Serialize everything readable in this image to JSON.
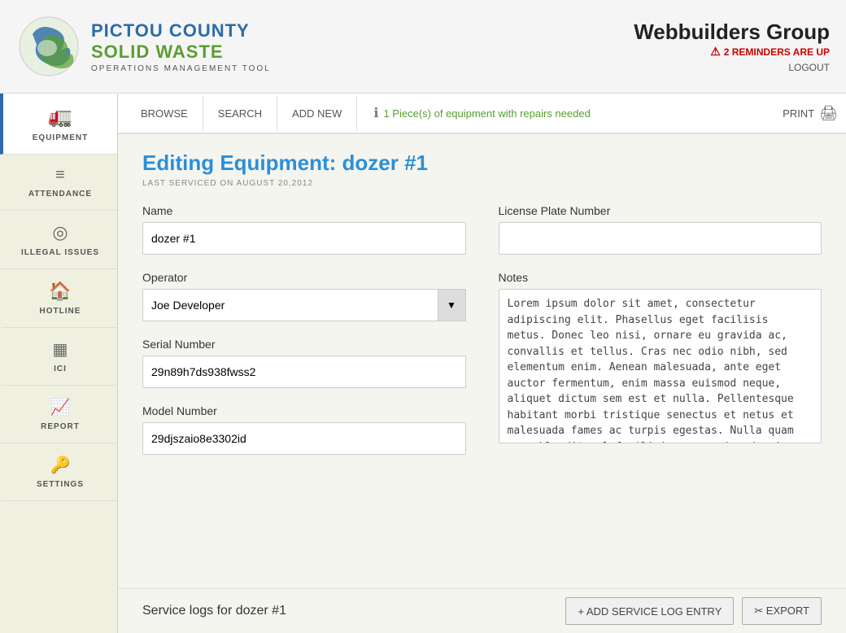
{
  "header": {
    "company": "Webbuilders Group",
    "reminders_text": "2 REMINDERS ARE UP",
    "logout": "LOGOUT",
    "logo_line1": "PICTOU COUNTY",
    "logo_line2": "SOLID WASTE",
    "logo_subtitle": "OPERATIONS MANAGEMENT TOOL"
  },
  "sidebar": {
    "items": [
      {
        "id": "equipment",
        "label": "EQUIPMENT",
        "icon": "🚛",
        "active": true
      },
      {
        "id": "attendance",
        "label": "ATTENDANCE",
        "icon": "≡",
        "active": false
      },
      {
        "id": "illegal-issues",
        "label": "ILLEGAL ISSUES",
        "icon": "◎",
        "active": false
      },
      {
        "id": "hotline",
        "label": "HOTLINE",
        "icon": "🏠",
        "active": false
      },
      {
        "id": "ici",
        "label": "ICI",
        "icon": "▦",
        "active": false
      },
      {
        "id": "report",
        "label": "REPORT",
        "icon": "📈",
        "active": false
      },
      {
        "id": "settings",
        "label": "SETTINGS",
        "icon": "🔑",
        "active": false
      }
    ]
  },
  "tabs": [
    {
      "label": "BROWSE"
    },
    {
      "label": "SEARCH"
    },
    {
      "label": "ADD NEW"
    }
  ],
  "tab_alert": "1 Piece(s) of equipment with repairs needed",
  "print_label": "PRINT",
  "form": {
    "title": "Editing Equipment: dozer #1",
    "subtitle": "LAST SERVICED ON AUGUST 20,2012",
    "name_label": "Name",
    "name_value": "dozer #1",
    "license_label": "License Plate Number",
    "license_value": "",
    "operator_label": "Operator",
    "operator_value": "Joe Developer",
    "notes_label": "Notes",
    "notes_value": "Lorem ipsum dolor sit amet, consectetur adipiscing elit. Phasellus eget facilisis metus. Donec leo nisi, ornare eu gravida ac, convallis et tellus. Cras nec odio nibh, sed elementum enim. Aenean malesuada, ante eget auctor fermentum, enim massa euismod neque, aliquet dictum sem est et nulla. Pellentesque habitant morbi tristique senectus et netus et malesuada fames ac turpis egestas. Nulla quam sem, blandit vel facilisis nec, euismod quis felis. Ut justo dolor, accumsan in malesuada eu, venenatis in elit. Proin eget ligula sit amet libero lacinia congue.",
    "serial_label": "Serial Number",
    "serial_value": "29n89h7ds938fwss2",
    "model_label": "Model Number",
    "model_value": "29djszaio8e3302id"
  },
  "service_logs": {
    "title": "Service logs for dozer #1",
    "add_btn": "+ ADD SERVICE LOG ENTRY",
    "export_btn": "✂ EXPORT"
  }
}
